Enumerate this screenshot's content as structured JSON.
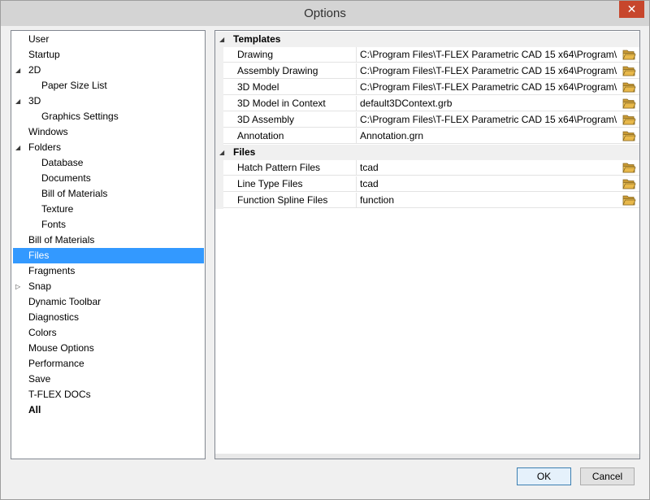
{
  "window": {
    "title": "Options",
    "close_glyph": "✕"
  },
  "tree": {
    "items": [
      {
        "label": "User",
        "level": 0,
        "expander": "",
        "selected": false,
        "bold": false
      },
      {
        "label": "Startup",
        "level": 0,
        "expander": "",
        "selected": false,
        "bold": false
      },
      {
        "label": "2D",
        "level": 0,
        "expander": "expanded",
        "selected": false,
        "bold": false
      },
      {
        "label": "Paper Size List",
        "level": 1,
        "expander": "",
        "selected": false,
        "bold": false
      },
      {
        "label": "3D",
        "level": 0,
        "expander": "expanded",
        "selected": false,
        "bold": false
      },
      {
        "label": "Graphics Settings",
        "level": 1,
        "expander": "",
        "selected": false,
        "bold": false
      },
      {
        "label": "Windows",
        "level": 0,
        "expander": "",
        "selected": false,
        "bold": false
      },
      {
        "label": "Folders",
        "level": 0,
        "expander": "expanded",
        "selected": false,
        "bold": false
      },
      {
        "label": "Database",
        "level": 1,
        "expander": "",
        "selected": false,
        "bold": false
      },
      {
        "label": "Documents",
        "level": 1,
        "expander": "",
        "selected": false,
        "bold": false
      },
      {
        "label": "Bill of Materials",
        "level": 1,
        "expander": "",
        "selected": false,
        "bold": false
      },
      {
        "label": "Texture",
        "level": 1,
        "expander": "",
        "selected": false,
        "bold": false
      },
      {
        "label": "Fonts",
        "level": 1,
        "expander": "",
        "selected": false,
        "bold": false
      },
      {
        "label": "Bill of Materials",
        "level": 0,
        "expander": "",
        "selected": false,
        "bold": false
      },
      {
        "label": "Files",
        "level": 0,
        "expander": "",
        "selected": true,
        "bold": false
      },
      {
        "label": "Fragments",
        "level": 0,
        "expander": "",
        "selected": false,
        "bold": false
      },
      {
        "label": "Snap",
        "level": 0,
        "expander": "collapsed",
        "selected": false,
        "bold": false
      },
      {
        "label": "Dynamic Toolbar",
        "level": 0,
        "expander": "",
        "selected": false,
        "bold": false
      },
      {
        "label": "Diagnostics",
        "level": 0,
        "expander": "",
        "selected": false,
        "bold": false
      },
      {
        "label": "Colors",
        "level": 0,
        "expander": "",
        "selected": false,
        "bold": false
      },
      {
        "label": "Mouse Options",
        "level": 0,
        "expander": "",
        "selected": false,
        "bold": false
      },
      {
        "label": "Performance",
        "level": 0,
        "expander": "",
        "selected": false,
        "bold": false
      },
      {
        "label": "Save",
        "level": 0,
        "expander": "",
        "selected": false,
        "bold": false
      },
      {
        "label": "T-FLEX DOCs",
        "level": 0,
        "expander": "",
        "selected": false,
        "bold": false
      },
      {
        "label": "All",
        "level": 0,
        "expander": "",
        "selected": false,
        "bold": true
      }
    ]
  },
  "property_grid": {
    "categories": [
      {
        "label": "Templates",
        "rows": [
          {
            "name": "Drawing",
            "value": "C:\\Program Files\\T-FLEX Parametric CAD 15 x64\\Program\\Te"
          },
          {
            "name": "Assembly Drawing",
            "value": "C:\\Program Files\\T-FLEX Parametric CAD 15 x64\\Program\\Te"
          },
          {
            "name": "3D Model",
            "value": "C:\\Program Files\\T-FLEX Parametric CAD 15 x64\\Program\\Te"
          },
          {
            "name": "3D Model in Context",
            "value": "default3DContext.grb"
          },
          {
            "name": "3D Assembly",
            "value": "C:\\Program Files\\T-FLEX Parametric CAD 15 x64\\Program\\Te"
          },
          {
            "name": "Annotation",
            "value": "Annotation.grn"
          }
        ]
      },
      {
        "label": "Files",
        "rows": [
          {
            "name": "Hatch Pattern Files",
            "value": "tcad"
          },
          {
            "name": "Line Type Files",
            "value": "tcad"
          },
          {
            "name": "Function Spline Files",
            "value": "function"
          }
        ]
      }
    ]
  },
  "buttons": {
    "ok": "OK",
    "cancel": "Cancel"
  },
  "colors": {
    "selection": "#3399ff",
    "close": "#c7462c",
    "folder": "#e8b84a"
  }
}
